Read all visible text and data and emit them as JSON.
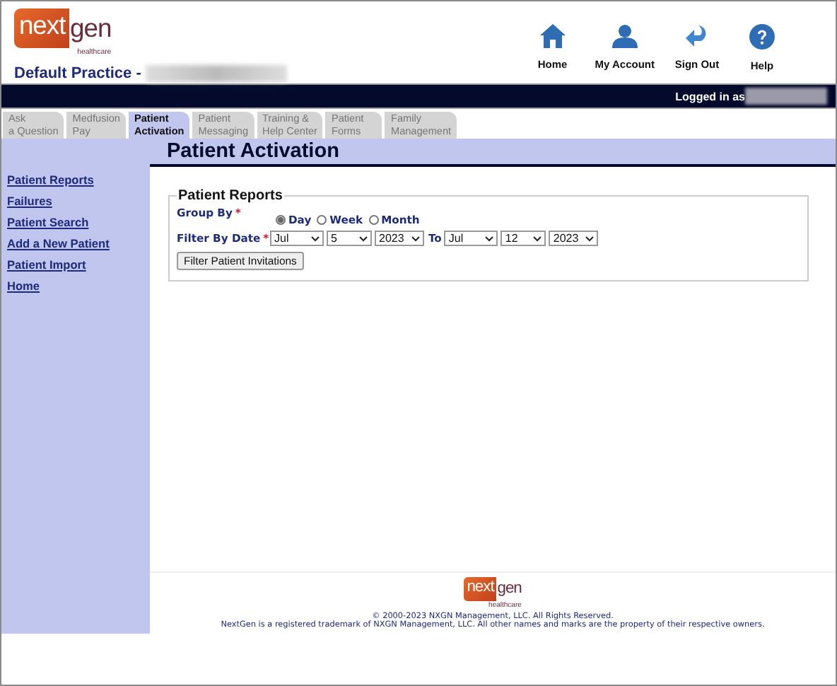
{
  "brand": {
    "part1": "next",
    "part2": "gen",
    "tagline": "healthcare"
  },
  "practice": "Default Practice -",
  "top_nav": [
    {
      "label": "Home"
    },
    {
      "label": "My Account"
    },
    {
      "label": "Sign Out"
    },
    {
      "label": "Help"
    }
  ],
  "logged_in": "Logged in as",
  "tabs": [
    {
      "lines": [
        "Ask",
        "a Question"
      ],
      "selected": false
    },
    {
      "lines": [
        "Medfusion",
        "Pay"
      ],
      "selected": false
    },
    {
      "lines": [
        "Patient",
        "Activation"
      ],
      "selected": true
    },
    {
      "lines": [
        "Patient",
        "Messaging"
      ],
      "selected": false
    },
    {
      "lines": [
        "Training &",
        "Help Center"
      ],
      "selected": false
    },
    {
      "lines": [
        "Patient",
        "Forms"
      ],
      "selected": false
    },
    {
      "lines": [
        "Family",
        "Management"
      ],
      "selected": false
    }
  ],
  "page_title": "Patient Activation",
  "sidebar": {
    "items": [
      "Patient Reports",
      "Failures",
      "Patient Search",
      "Add a New Patient",
      "Patient Import",
      "Home"
    ]
  },
  "form": {
    "legend": "Patient Reports",
    "group_by": {
      "label": "Group By",
      "required_mark": "*",
      "options": [
        {
          "label": "Day",
          "selected": true
        },
        {
          "label": "Week",
          "selected": false
        },
        {
          "label": "Month",
          "selected": false
        }
      ]
    },
    "filter_by_date": {
      "label": "Filter By Date",
      "required_mark": "*",
      "from": {
        "month": "Jul",
        "day": "5",
        "year": "2023"
      },
      "to_label": "To",
      "to": {
        "month": "Jul",
        "day": "12",
        "year": "2023"
      }
    },
    "button": "Filter Patient Invitations"
  },
  "footer": {
    "brand": {
      "part1": "next",
      "part2": "gen",
      "tagline": "healthcare"
    },
    "copyright": "© 2000-2023 NXGN Management, LLC. All Rights Reserved.",
    "trademark": "NextGen is a registered trademark of NXGN Management, LLC. All other names and marks are the property of their respective owners."
  }
}
